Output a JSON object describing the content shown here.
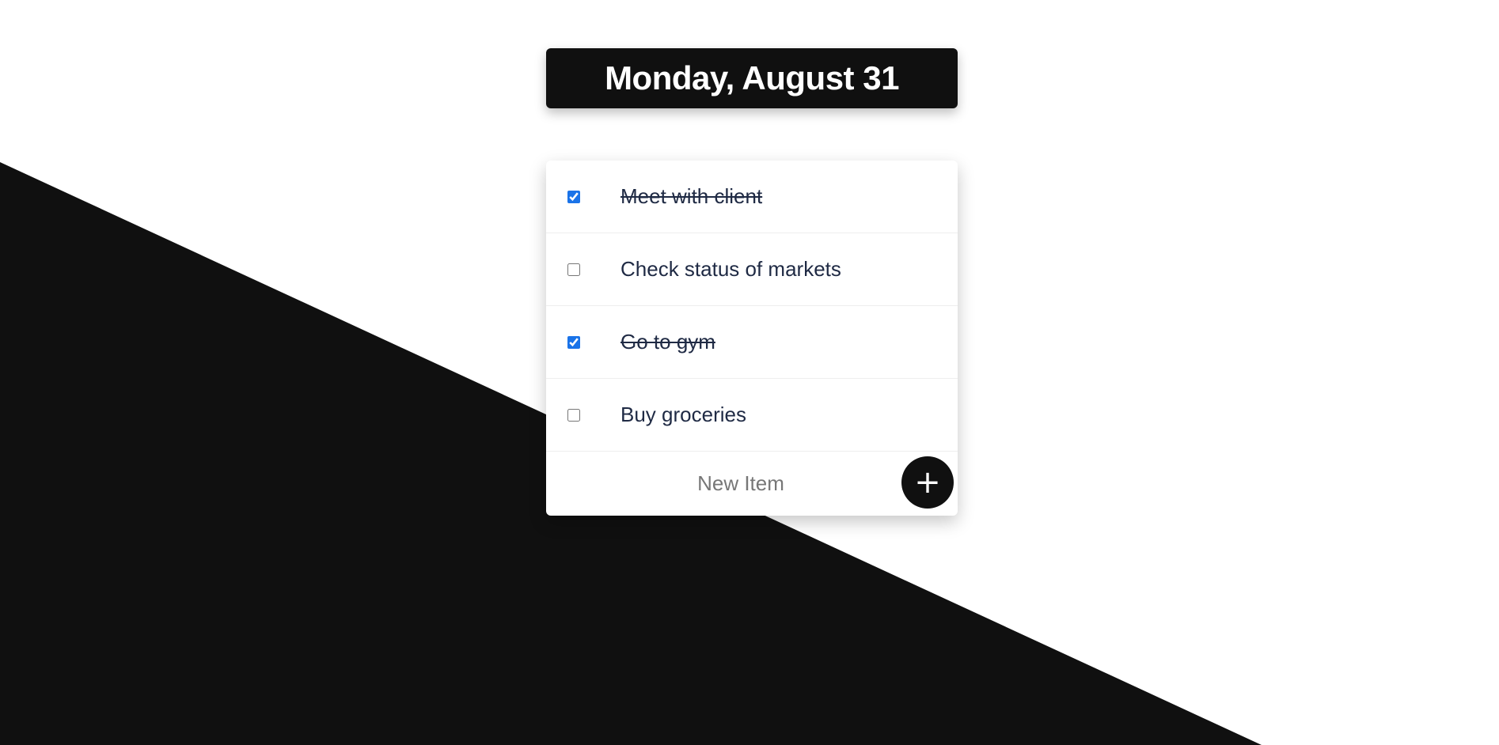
{
  "header": {
    "date_title": "Monday, August 31"
  },
  "todos": [
    {
      "label": "Meet with client",
      "checked": true
    },
    {
      "label": "Check status of markets",
      "checked": false
    },
    {
      "label": "Go to gym",
      "checked": true
    },
    {
      "label": "Buy groceries",
      "checked": false
    }
  ],
  "new_item": {
    "placeholder": "New Item",
    "add_icon": "+"
  },
  "colors": {
    "dark": "#101010",
    "checkbox_accent": "#1a73e8",
    "text": "#1f2a44"
  }
}
